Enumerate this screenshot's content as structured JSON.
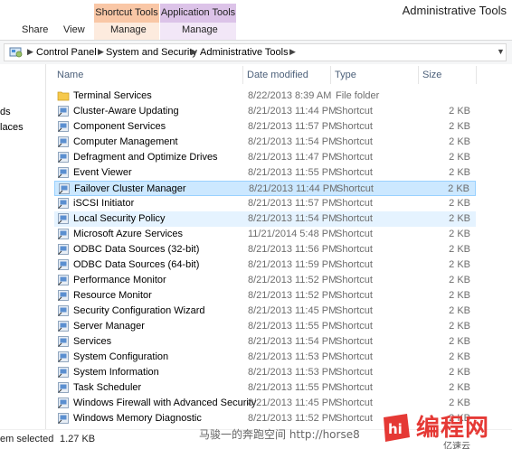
{
  "ribbon": {
    "context_tabs": {
      "shortcut_tools": "Shortcut Tools",
      "application_tools": "Application Tools"
    },
    "title": "Administrative Tools",
    "tabs": [
      "Share",
      "View",
      "Manage",
      "Manage"
    ]
  },
  "address_bar": {
    "crumbs": [
      "Control Panel",
      "System and Security",
      "Administrative Tools"
    ]
  },
  "nav_pane": {
    "items": [
      "ds",
      "laces"
    ]
  },
  "columns": {
    "name": "Name",
    "date": "Date modified",
    "type": "Type",
    "size": "Size"
  },
  "files": [
    {
      "name": "Terminal Services",
      "date": "8/22/2013 8:39 AM",
      "type": "File folder",
      "size": "",
      "icon": "folder-icon"
    },
    {
      "name": "Cluster-Aware Updating",
      "date": "8/21/2013 11:44 PM",
      "type": "Shortcut",
      "size": "2 KB",
      "icon": "cluster-update-icon"
    },
    {
      "name": "Component Services",
      "date": "8/21/2013 11:57 PM",
      "type": "Shortcut",
      "size": "2 KB",
      "icon": "component-services-icon"
    },
    {
      "name": "Computer Management",
      "date": "8/21/2013 11:54 PM",
      "type": "Shortcut",
      "size": "2 KB",
      "icon": "computer-management-icon"
    },
    {
      "name": "Defragment and Optimize Drives",
      "date": "8/21/2013 11:47 PM",
      "type": "Shortcut",
      "size": "2 KB",
      "icon": "defrag-icon"
    },
    {
      "name": "Event Viewer",
      "date": "8/21/2013 11:55 PM",
      "type": "Shortcut",
      "size": "2 KB",
      "icon": "event-viewer-icon"
    },
    {
      "name": "Failover Cluster Manager",
      "date": "8/21/2013 11:44 PM",
      "type": "Shortcut",
      "size": "2 KB",
      "icon": "failover-cluster-icon"
    },
    {
      "name": "iSCSI Initiator",
      "date": "8/21/2013 11:57 PM",
      "type": "Shortcut",
      "size": "2 KB",
      "icon": "iscsi-icon"
    },
    {
      "name": "Local Security Policy",
      "date": "8/21/2013 11:54 PM",
      "type": "Shortcut",
      "size": "2 KB",
      "icon": "security-policy-icon"
    },
    {
      "name": "Microsoft Azure Services",
      "date": "11/21/2014 5:48 PM",
      "type": "Shortcut",
      "size": "2 KB",
      "icon": "azure-icon"
    },
    {
      "name": "ODBC Data Sources (32-bit)",
      "date": "8/21/2013 11:56 PM",
      "type": "Shortcut",
      "size": "2 KB",
      "icon": "odbc-icon"
    },
    {
      "name": "ODBC Data Sources (64-bit)",
      "date": "8/21/2013 11:59 PM",
      "type": "Shortcut",
      "size": "2 KB",
      "icon": "odbc-icon"
    },
    {
      "name": "Performance Monitor",
      "date": "8/21/2013 11:52 PM",
      "type": "Shortcut",
      "size": "2 KB",
      "icon": "performance-monitor-icon"
    },
    {
      "name": "Resource Monitor",
      "date": "8/21/2013 11:52 PM",
      "type": "Shortcut",
      "size": "2 KB",
      "icon": "resource-monitor-icon"
    },
    {
      "name": "Security Configuration Wizard",
      "date": "8/21/2013 11:45 PM",
      "type": "Shortcut",
      "size": "2 KB",
      "icon": "security-wizard-icon"
    },
    {
      "name": "Server Manager",
      "date": "8/21/2013 11:55 PM",
      "type": "Shortcut",
      "size": "2 KB",
      "icon": "server-manager-icon"
    },
    {
      "name": "Services",
      "date": "8/21/2013 11:54 PM",
      "type": "Shortcut",
      "size": "2 KB",
      "icon": "services-icon"
    },
    {
      "name": "System Configuration",
      "date": "8/21/2013 11:53 PM",
      "type": "Shortcut",
      "size": "2 KB",
      "icon": "system-config-icon"
    },
    {
      "name": "System Information",
      "date": "8/21/2013 11:53 PM",
      "type": "Shortcut",
      "size": "2 KB",
      "icon": "system-info-icon"
    },
    {
      "name": "Task Scheduler",
      "date": "8/21/2013 11:55 PM",
      "type": "Shortcut",
      "size": "2 KB",
      "icon": "task-scheduler-icon"
    },
    {
      "name": "Windows Firewall with Advanced Security",
      "date": "8/21/2013 11:45 PM",
      "type": "Shortcut",
      "size": "2 KB",
      "icon": "firewall-icon"
    },
    {
      "name": "Windows Memory Diagnostic",
      "date": "8/21/2013 11:52 PM",
      "type": "Shortcut",
      "size": "2 KB",
      "icon": "memory-diagnostic-icon"
    }
  ],
  "selected_index": 6,
  "hover_index": 8,
  "status": {
    "selected": "em selected",
    "size": "1.27 KB"
  },
  "watermark": "马骏一的奔跑空间 http://horse8",
  "logo": {
    "mark": "hi",
    "text": "编程网",
    "sub": "亿速云"
  },
  "colors": {
    "selected_bg": "#cce8ff",
    "hover_bg": "#e5f3ff",
    "shortcut_tools": "#f9c7a6",
    "application_tools": "#dcc3e8",
    "logo_red": "#e53935"
  }
}
